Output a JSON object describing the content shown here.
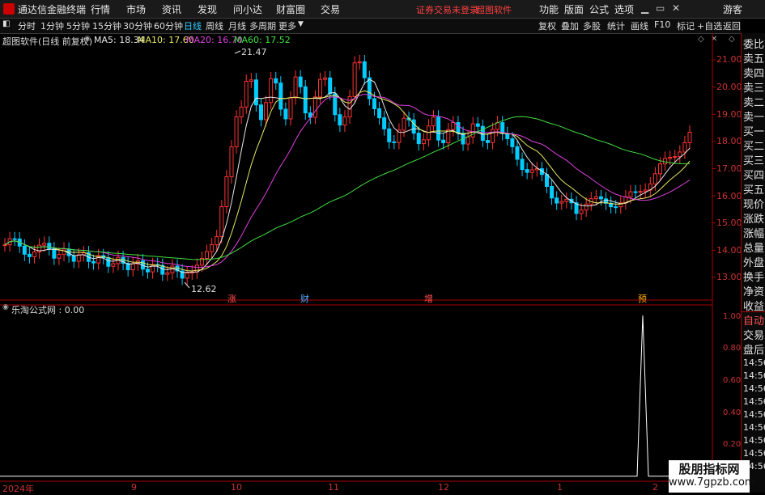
{
  "app": {
    "title": "通达信金融终端"
  },
  "menu": [
    "行情",
    "市场",
    "资讯",
    "发现",
    "问小达",
    "财富圈",
    "交易"
  ],
  "status": {
    "broker": "证券交易未登录",
    "brand": "超图软件"
  },
  "right_menu": [
    "功能",
    "版面",
    "公式",
    "选项"
  ],
  "guest": "游客",
  "window_buttons": [
    "▁",
    "▭",
    "✕"
  ],
  "periods": [
    "分时",
    "1分钟",
    "5分钟",
    "15分钟",
    "30分钟",
    "60分钟",
    "日线",
    "周线",
    "月线",
    "多周期",
    "更多"
  ],
  "active_period": "日线",
  "tools": [
    "复权",
    "叠加",
    "多股",
    "统计",
    "画线",
    "F10",
    "标记",
    "+自选",
    "返回"
  ],
  "chart": {
    "stock_label": "超图软件(日线 前复权)",
    "ma": [
      {
        "name": "MA5: 18.34",
        "color": "#e8e8e8"
      },
      {
        "name": "MA10: 17.60",
        "color": "#e8e860"
      },
      {
        "name": "MA20: 16.70",
        "color": "#e040e0"
      },
      {
        "name": "MA60: 17.52",
        "color": "#40e040"
      }
    ],
    "high_label": "21.47",
    "low_label": "12.62",
    "price_ticks": [
      "21.00",
      "20.00",
      "19.00",
      "18.00",
      "17.00",
      "16.00",
      "15.00",
      "14.00",
      "13.00"
    ],
    "events": [
      {
        "label": "涨",
        "color": "#ff5050"
      },
      {
        "label": "财",
        "color": "#55aaff"
      },
      {
        "label": "增",
        "color": "#ff5050"
      },
      {
        "label": "预",
        "color": "#ffaa00"
      }
    ]
  },
  "indicator": {
    "title": "乐淘公式网 : 0.00",
    "ticks": [
      "1.00",
      "0.80",
      "0.60",
      "0.40",
      "0.20"
    ]
  },
  "x_axis": [
    "2024年",
    "9",
    "10",
    "11",
    "12",
    "1",
    "2"
  ],
  "sidebar": {
    "items": [
      "委比",
      "卖五",
      "卖四",
      "卖三",
      "卖二",
      "卖一",
      "买一",
      "买二",
      "买三",
      "买四",
      "买五",
      "现价",
      "涨跌",
      "涨幅",
      "总量",
      "外盘",
      "换手",
      "净资",
      "收益"
    ],
    "tabs": [
      "自动",
      "交易",
      "盘后"
    ],
    "times": [
      "14:56",
      "14:56",
      "14:56",
      "14:56",
      "14:56",
      "14:56",
      "14:56",
      "14:56",
      "14:56"
    ]
  },
  "watermark": {
    "title": "股朋指标网",
    "url": "www.7gpzb.com"
  },
  "colors": {
    "up": "#ff3333",
    "down": "#00ccff",
    "axis": "#aa0000",
    "active": "#33ccff"
  }
}
